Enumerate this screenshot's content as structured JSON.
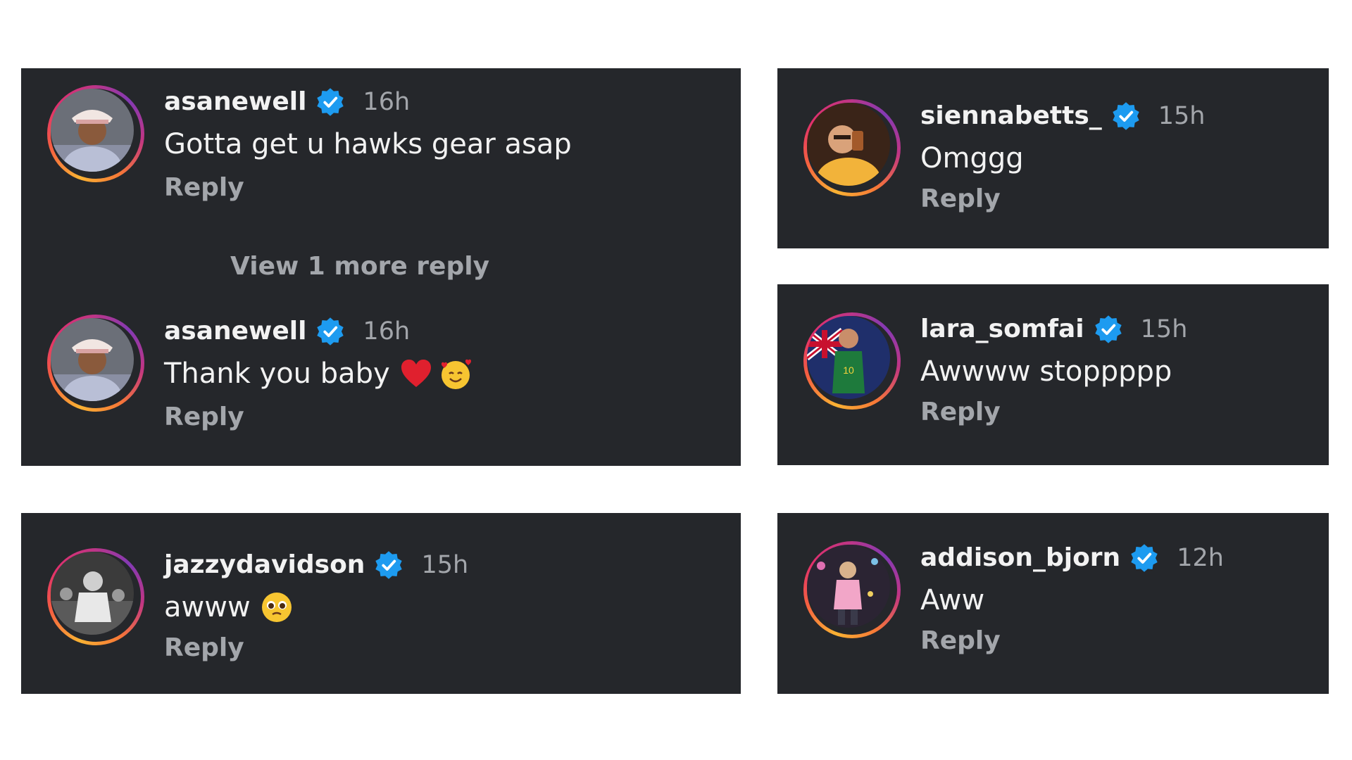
{
  "colors": {
    "card_background": "#25272b",
    "page_background": "#ffffff",
    "verified_badge": "#1d9bf0",
    "primary_text": "#f2f2f2",
    "secondary_text": "#a3a6ab"
  },
  "cards": [
    {
      "comments": [
        {
          "username": "asanewell",
          "time": "16h",
          "text": "Gotta get u hawks gear asap",
          "reply_label": "Reply",
          "avatar": "avatar-photo",
          "verified_icon": "verified-badge-icon"
        }
      ],
      "view_more_label": "View 1 more reply",
      "replies": [
        {
          "username": "asanewell",
          "time": "16h",
          "text": "Thank you baby",
          "emojis": [
            "red-heart-emoji",
            "smiling-face-with-hearts-emoji"
          ],
          "reply_label": "Reply",
          "avatar": "avatar-photo",
          "verified_icon": "verified-badge-icon"
        }
      ]
    },
    {
      "comments": [
        {
          "username": "siennabetts_",
          "time": "15h",
          "text": "Omggg",
          "reply_label": "Reply",
          "avatar": "avatar-photo",
          "verified_icon": "verified-badge-icon"
        }
      ]
    },
    {
      "comments": [
        {
          "username": "lara_somfai",
          "time": "15h",
          "text": "Awwww stoppppp",
          "reply_label": "Reply",
          "avatar": "avatar-photo",
          "verified_icon": "verified-badge-icon"
        }
      ]
    },
    {
      "comments": [
        {
          "username": "jazzydavidson",
          "time": "15h",
          "text": "awww",
          "emojis": [
            "pleading-face-emoji"
          ],
          "reply_label": "Reply",
          "avatar": "avatar-photo",
          "verified_icon": "verified-badge-icon"
        }
      ]
    },
    {
      "comments": [
        {
          "username": "addison_bjorn",
          "time": "12h",
          "text": "Aww",
          "reply_label": "Reply",
          "avatar": "avatar-photo",
          "verified_icon": "verified-badge-icon"
        }
      ]
    }
  ]
}
